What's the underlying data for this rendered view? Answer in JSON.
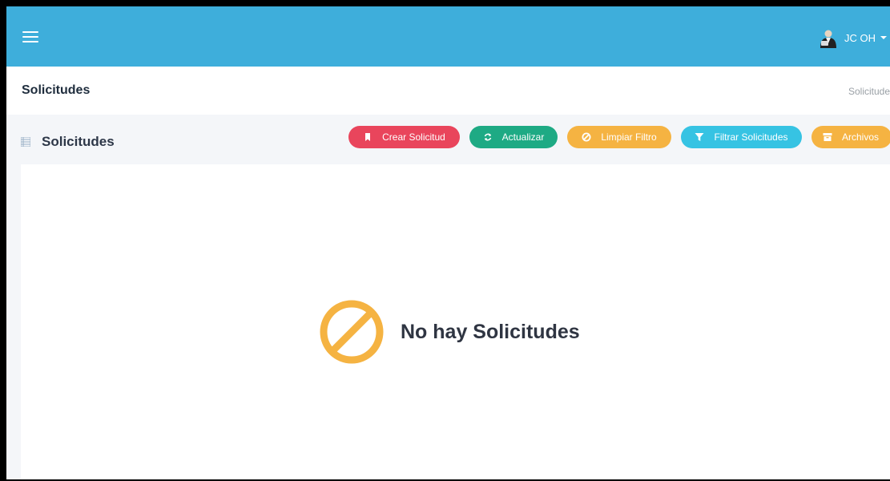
{
  "navbar": {
    "menu_icon": "hamburger-icon",
    "user_name": "JC OH",
    "avatar_icon": "user-avatar"
  },
  "header": {
    "title": "Solicitudes",
    "breadcrumb": "Solicitudes"
  },
  "card": {
    "title": "Solicitudes",
    "title_icon": "list-icon"
  },
  "toolbar": {
    "create_label": "Crear Solicitud",
    "refresh_label": "Actualizar",
    "clear_filter_label": "Limpiar Filtro",
    "filter_label": "Filtrar Solicitudes",
    "archive_label": "Archivos"
  },
  "empty_state": {
    "icon": "ban-icon",
    "message": "No hay Solicitudes"
  },
  "colors": {
    "navbar": "#3eaedb",
    "create": "#e9455c",
    "refresh": "#1eaa84",
    "clear_filter": "#f5b342",
    "filter": "#36c3e3",
    "archive": "#f5b342",
    "empty_icon": "#f5b342"
  }
}
